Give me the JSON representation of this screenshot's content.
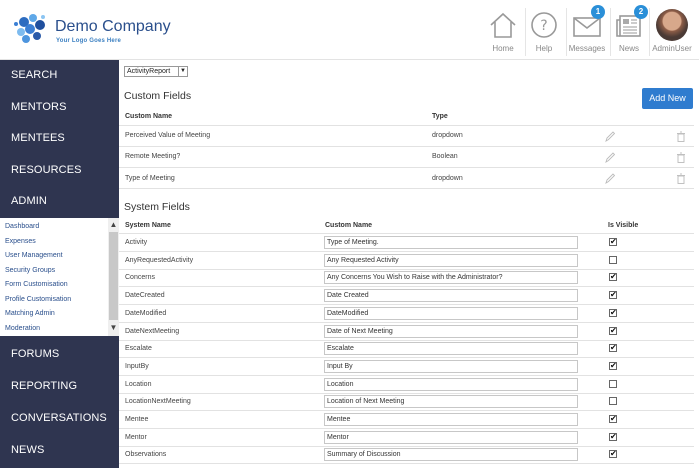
{
  "header": {
    "company": "Demo Company",
    "tagline": "Your Logo Goes Here",
    "nav": [
      {
        "label": "Home",
        "icon": "home-icon"
      },
      {
        "label": "Help",
        "icon": "help-icon"
      },
      {
        "label": "Messages",
        "icon": "envelope-icon",
        "badge": "1"
      },
      {
        "label": "News",
        "icon": "newspaper-icon",
        "badge": "2"
      },
      {
        "label": "AdminUser",
        "icon": "avatar"
      }
    ]
  },
  "sidebar": {
    "top_items": [
      "SEARCH",
      "MENTORS",
      "MENTEES",
      "RESOURCES",
      "ADMIN"
    ],
    "admin_sub": [
      "Dashboard",
      "Expenses",
      "User Management",
      "Security Groups",
      "Form Customisation",
      "Profile Customisation",
      "Matching Admin",
      "Moderation"
    ],
    "bottom_items": [
      "FORUMS",
      "REPORTING",
      "CONVERSATIONS",
      "NEWS"
    ]
  },
  "main": {
    "select_value": "ActivityReport",
    "custom_fields": {
      "title": "Custom Fields",
      "add_label": "Add New",
      "headers": {
        "name": "Custom Name",
        "type": "Type"
      },
      "rows": [
        {
          "name": "Perceived Value of Meeting",
          "type": "dropdown"
        },
        {
          "name": "Remote Meeting?",
          "type": "Boolean"
        },
        {
          "name": "Type of Meeting",
          "type": "dropdown"
        }
      ]
    },
    "system_fields": {
      "title": "System Fields",
      "headers": {
        "system": "System Name",
        "custom": "Custom Name",
        "visible": "Is Visible"
      },
      "rows": [
        {
          "system": "Activity",
          "custom": "Type of Meeting.",
          "visible": true
        },
        {
          "system": "AnyRequestedActivity",
          "custom": "Any Requested Activity",
          "visible": false
        },
        {
          "system": "Concerns",
          "custom": "Any Concerns You Wish to Raise with the Administrator?",
          "visible": true
        },
        {
          "system": "DateCreated",
          "custom": "Date Created",
          "visible": true
        },
        {
          "system": "DateModified",
          "custom": "DateModified",
          "visible": true
        },
        {
          "system": "DateNextMeeting",
          "custom": "Date of Next Meeting",
          "visible": true
        },
        {
          "system": "Escalate",
          "custom": "Escalate",
          "visible": true
        },
        {
          "system": "InputBy",
          "custom": "Input By",
          "visible": true
        },
        {
          "system": "Location",
          "custom": "Location",
          "visible": false
        },
        {
          "system": "LocationNextMeeting",
          "custom": "Location of Next Meeting",
          "visible": false
        },
        {
          "system": "Mentee",
          "custom": "Mentee",
          "visible": true
        },
        {
          "system": "Mentor",
          "custom": "Mentor",
          "visible": true
        },
        {
          "system": "Observations",
          "custom": "Summary of Discussion",
          "visible": true
        }
      ]
    }
  }
}
